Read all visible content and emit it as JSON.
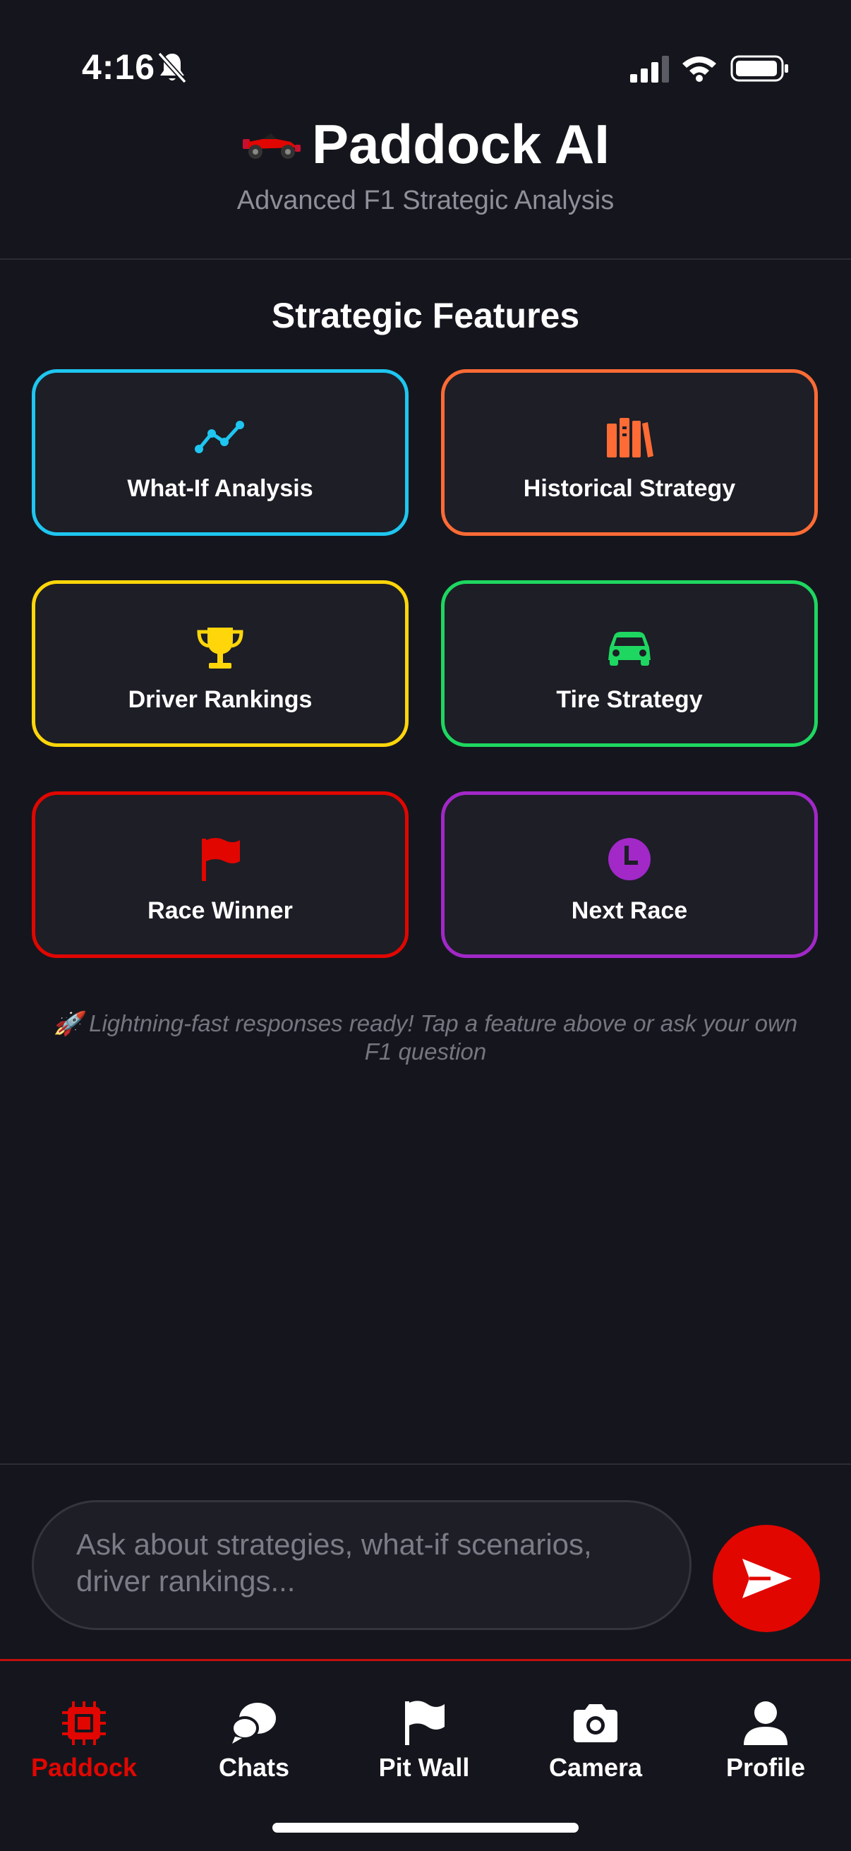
{
  "status_bar": {
    "time": "4:16"
  },
  "header": {
    "title": "Paddock AI",
    "subtitle": "Advanced F1 Strategic Analysis",
    "logo_icon": "race-car-emoji"
  },
  "features": {
    "title": "Strategic Features",
    "cards": [
      {
        "label": "What-If Analysis",
        "icon": "trend-line-icon",
        "color": "#1ec6f0"
      },
      {
        "label": "Historical Strategy",
        "icon": "books-icon",
        "color": "#ff6b35"
      },
      {
        "label": "Driver Rankings",
        "icon": "trophy-icon",
        "color": "#ffd60a"
      },
      {
        "label": "Tire Strategy",
        "icon": "car-icon",
        "color": "#1ed760"
      },
      {
        "label": "Race Winner",
        "icon": "flag-icon",
        "color": "#e10600"
      },
      {
        "label": "Next Race",
        "icon": "clock-icon",
        "color": "#a228c8"
      }
    ]
  },
  "hint": "🚀 Lightning-fast responses ready! Tap a feature above or ask your own F1 question",
  "composer": {
    "placeholder": "Ask about strategies, what-if scenarios, driver rankings..."
  },
  "tabs": [
    {
      "label": "Paddock",
      "icon": "chip-icon",
      "active": true
    },
    {
      "label": "Chats",
      "icon": "chat-bubbles-icon",
      "active": false
    },
    {
      "label": "Pit Wall",
      "icon": "flag-icon",
      "active": false
    },
    {
      "label": "Camera",
      "icon": "camera-icon",
      "active": false
    },
    {
      "label": "Profile",
      "icon": "person-icon",
      "active": false
    }
  ],
  "colors": {
    "background": "#15161d",
    "card_background": "#1d1e26",
    "accent_red": "#e10600",
    "muted_text": "#8e8f98"
  }
}
